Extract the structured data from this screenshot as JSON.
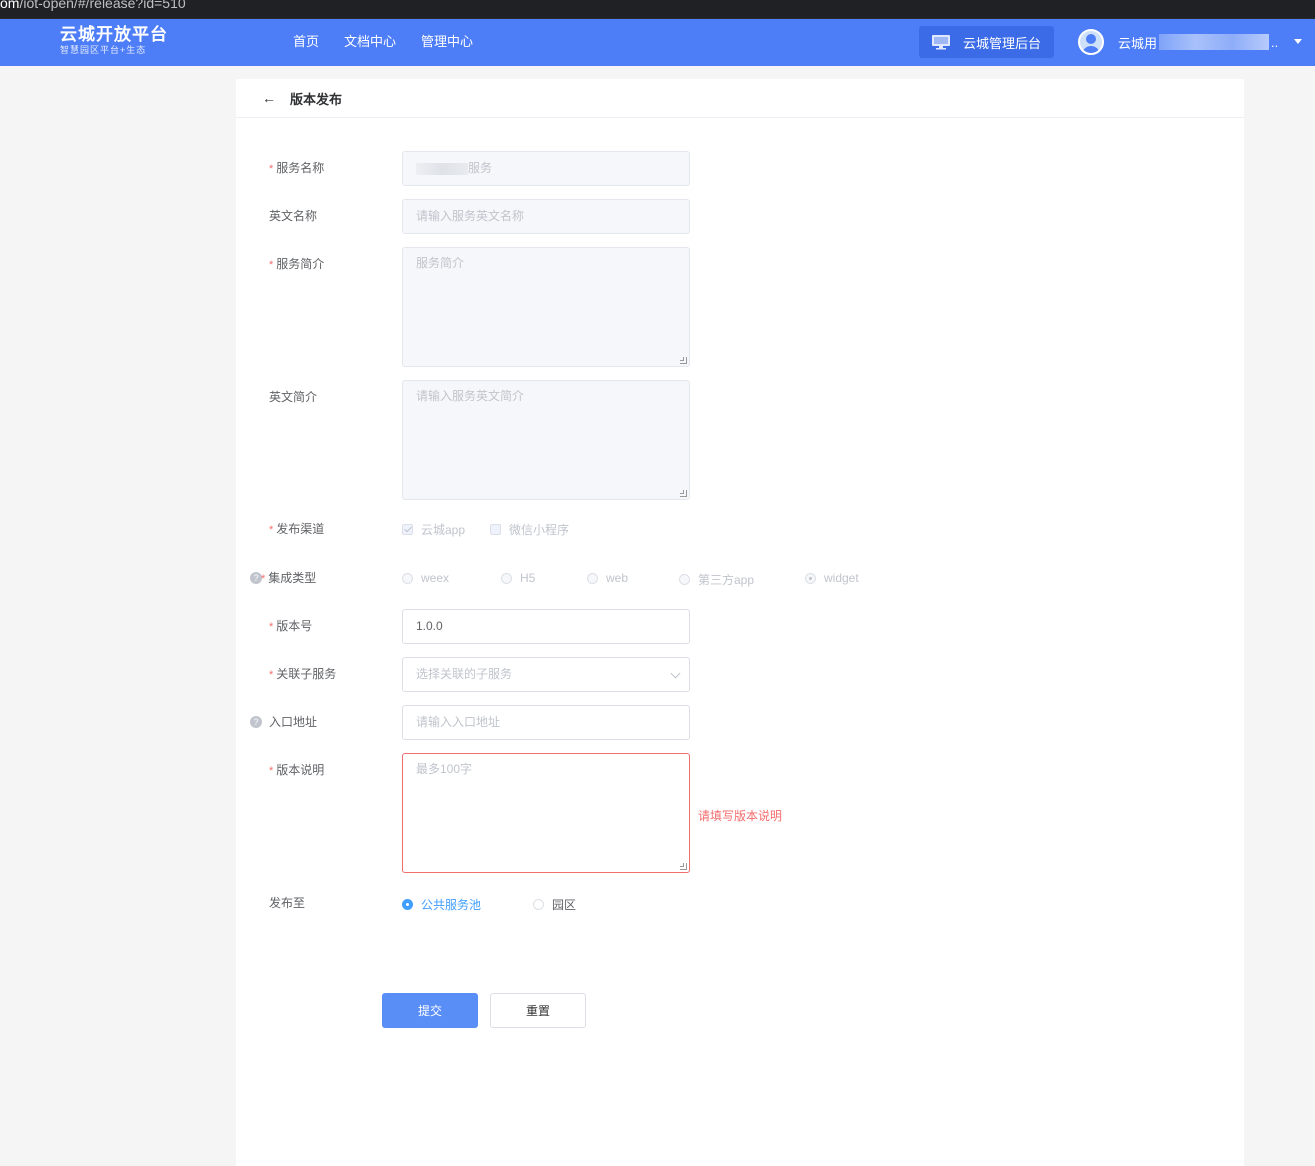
{
  "browser": {
    "url_domain": "om",
    "url_rest": "/iot-open/#/release?id=510"
  },
  "header": {
    "logo_title": "云城开放平台",
    "logo_subtitle": "智慧园区平台+生态",
    "nav": [
      "首页",
      "文档中心",
      "管理中心"
    ],
    "admin_label": "云城管理后台",
    "user_name": "云城用",
    "user_more": "..",
    "brand_color": "#4e7ef7"
  },
  "page": {
    "title": "版本发布"
  },
  "form": {
    "service_name": {
      "label": "服务名称",
      "value_suffix": "服务"
    },
    "english_name": {
      "label": "英文名称",
      "placeholder": "请输入服务英文名称"
    },
    "service_intro": {
      "label": "服务简介",
      "placeholder": "服务简介"
    },
    "english_intro": {
      "label": "英文简介",
      "placeholder": "请输入服务英文简介"
    },
    "channel": {
      "label": "发布渠道",
      "options": [
        "云城app",
        "微信小程序"
      ],
      "checked": [
        true,
        false
      ]
    },
    "integration": {
      "label": "集成类型",
      "options": [
        "weex",
        "H5",
        "web",
        "第三方app",
        "widget"
      ],
      "selected": "widget"
    },
    "version": {
      "label": "版本号",
      "value": "1.0.0"
    },
    "sub_service": {
      "label": "关联子服务",
      "placeholder": "选择关联的子服务"
    },
    "entry": {
      "label": "入口地址",
      "placeholder": "请输入入口地址"
    },
    "notes": {
      "label": "版本说明",
      "placeholder": "最多100字",
      "error": "请填写版本说明"
    },
    "publish_to": {
      "label": "发布至",
      "options": [
        "公共服务池",
        "园区"
      ],
      "selected": "公共服务池"
    },
    "required_mark": "*",
    "help_mark": "?"
  },
  "actions": {
    "submit": "提交",
    "reset": "重置"
  }
}
